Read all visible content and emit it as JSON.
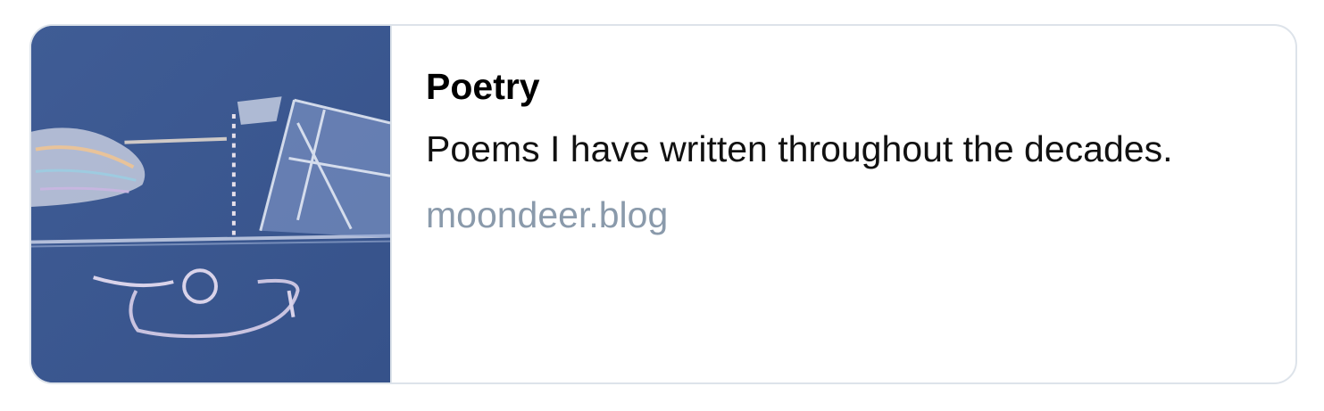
{
  "card": {
    "title": "Poetry",
    "description": "Poems I have written throughout the decades.",
    "domain": "moondeer.blog"
  },
  "thumbnail": {
    "icon": "chalk-drawing-thumbnail",
    "background_color": "#3d5a91"
  },
  "colors": {
    "title": "#000000",
    "description": "#111111",
    "domain": "#8a9aab",
    "border": "#dde3ea"
  }
}
